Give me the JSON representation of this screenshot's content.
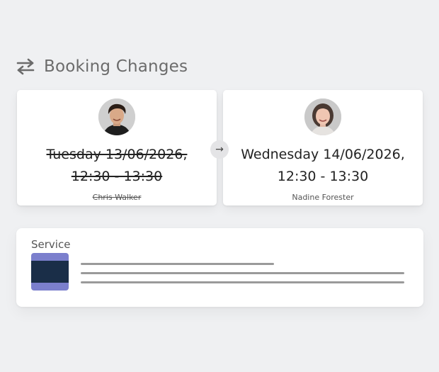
{
  "header": {
    "icon": "swap-arrows-icon",
    "title": "Booking Changes"
  },
  "old_booking": {
    "date_line": "Tuesday 13/06/2026,",
    "time_line": "12:30 - 13:30",
    "person": "Chris Walker",
    "status": "struck-through"
  },
  "transition_icon": "→",
  "new_booking": {
    "date_line": "Wednesday 14/06/2026,",
    "time_line": "12:30 - 13:30",
    "person": "Nadine Forester"
  },
  "service": {
    "label": "Service",
    "thumbnail_colors": {
      "outer": "#7b7fcd",
      "band": "#1a2e48"
    }
  },
  "colors": {
    "background": "#eff0f2",
    "card": "#ffffff",
    "placeholder_line": "#9a9a9a"
  }
}
